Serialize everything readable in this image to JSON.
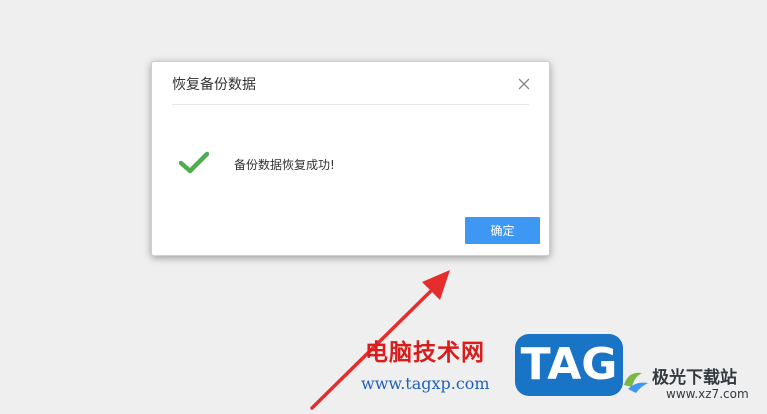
{
  "dialog": {
    "title": "恢复备份数据",
    "message": "备份数据恢复成功!",
    "ok_label": "确定"
  },
  "watermark": {
    "site_name": "电脑技术网",
    "url": "www.tagxp.com",
    "logo_text": "TAG"
  },
  "site_badge": {
    "name": "极光下载站",
    "url": "www.xz7.com"
  },
  "colors": {
    "accent": "#3e97f2",
    "success": "#4cae4c",
    "annotation": "#e52d2d"
  },
  "icons": {
    "close": "close-icon",
    "success": "checkmark-icon",
    "arrow": "arrow-annotation-icon"
  }
}
